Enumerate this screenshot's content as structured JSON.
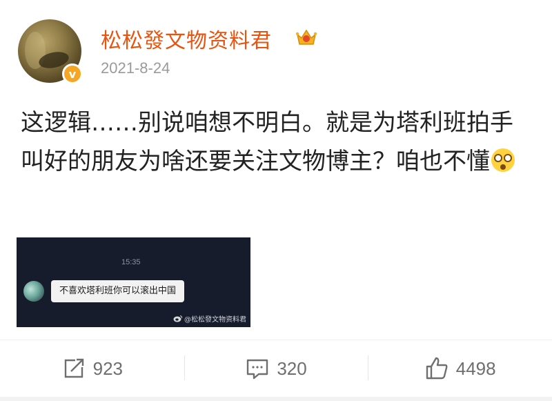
{
  "post": {
    "username": "松松發文物资料君",
    "date": "2021-8-24",
    "verified_badge": "v",
    "text": "这逻辑……别说咱想不明白。就是为塔利班拍手叫好的朋友为啥还要关注文物博主？咱也不懂"
  },
  "attachment": {
    "time": "15:35",
    "message": "不喜欢塔利班你可以滚出中国",
    "watermark": "@松松發文物资料君"
  },
  "actions": {
    "repost_count": "923",
    "comment_count": "320",
    "like_count": "4498"
  },
  "colors": {
    "username": "#e8540f",
    "verified": "#f5a623",
    "image_bg": "#161c2c"
  }
}
